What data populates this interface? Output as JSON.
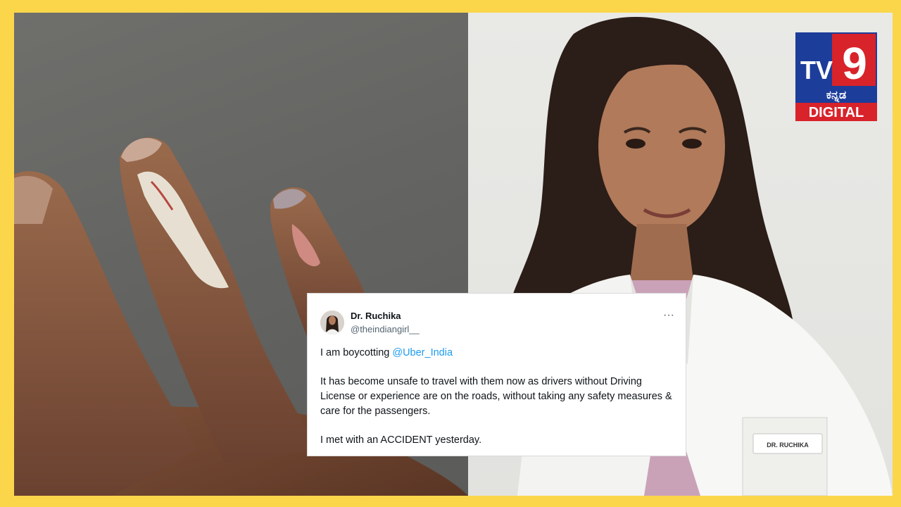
{
  "logo": {
    "number": "9",
    "script": "ಕನ್ನಡ",
    "tagline": "DIGITAL"
  },
  "right_photo": {
    "badge_text": "DR. RUCHIKA"
  },
  "tweet": {
    "author_name": "Dr. Ruchika",
    "author_handle": "@theindiangirl__",
    "more_label": "···",
    "line1_prefix": "I am boycotting ",
    "mention": "@Uber_India",
    "paragraph2": "It has become unsafe to travel with them now as drivers without Driving License or experience are on the roads, without taking any safety measures & care for the passengers.",
    "paragraph3": "I met with an ACCIDENT yesterday."
  },
  "colors": {
    "frame": "#fbd64a",
    "mention": "#1d9bf0",
    "logo_blue": "#1d3d9a",
    "logo_red": "#d8232a"
  }
}
